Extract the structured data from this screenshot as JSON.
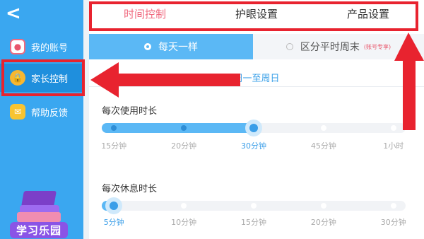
{
  "sidebar": {
    "back_glyph": "<",
    "items": [
      {
        "label": "我的账号",
        "icon": "account-icon"
      },
      {
        "label": "家长控制",
        "icon": "lock-icon"
      },
      {
        "label": "帮助反馈",
        "icon": "mail-icon"
      }
    ],
    "logo_text": "学习乐园"
  },
  "tabs": [
    {
      "label": "时间控制",
      "active": true
    },
    {
      "label": "护眼设置",
      "active": false
    },
    {
      "label": "产品设置",
      "active": false
    }
  ],
  "mode": {
    "same_every_day": "每天一样",
    "weekday_weekend": "区分平时周末",
    "account_exclusive_tip": "(账号专享)"
  },
  "week_range_label": "周一至周日",
  "use_duration": {
    "title": "每次使用时长",
    "options": [
      "15分钟",
      "20分钟",
      "30分钟",
      "45分钟",
      "1小时"
    ],
    "selected_index": 2
  },
  "rest_duration": {
    "title": "每次休息时长",
    "options": [
      "5分钟",
      "10分钟",
      "15分钟",
      "20分钟",
      "30分钟"
    ],
    "selected_index": 0
  },
  "colors": {
    "sidebar": "#3aa7f0",
    "accent_blue": "#5bb8f5",
    "active_tab": "#f06a7f",
    "annotation_red": "#e8232f"
  }
}
